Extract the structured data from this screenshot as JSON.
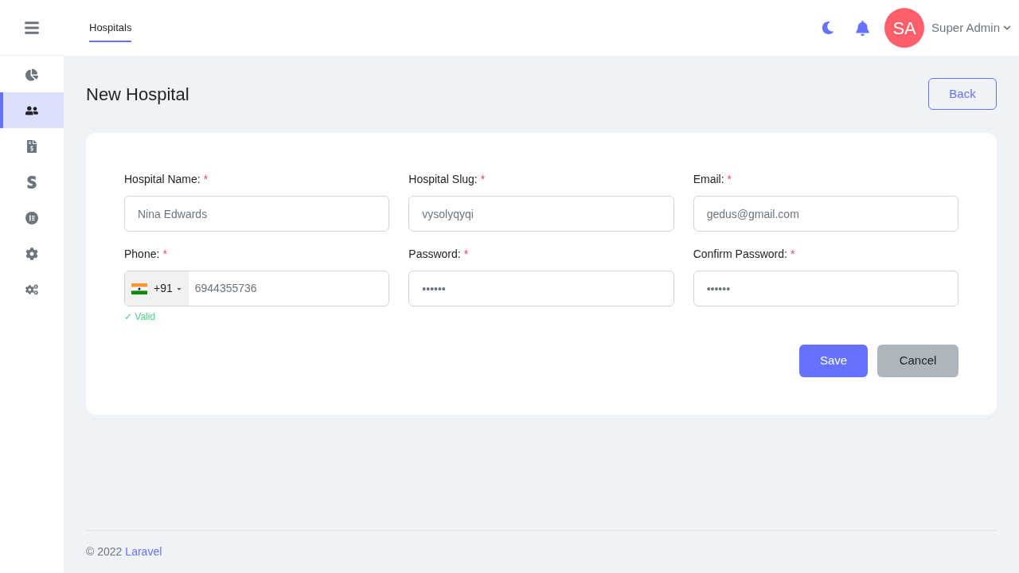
{
  "header": {
    "tabs": [
      {
        "label": "Hospitals",
        "selected": true
      }
    ],
    "avatar": "SA",
    "user": "Super Admin"
  },
  "sidebar": {
    "items": [
      {
        "kind": "chart",
        "selected": false
      },
      {
        "kind": "users",
        "selected": true
      },
      {
        "kind": "invoice",
        "selected": false
      },
      {
        "kind": "stripe",
        "selected": false
      },
      {
        "kind": "list",
        "selected": false
      },
      {
        "kind": "cog",
        "selected": false
      },
      {
        "kind": "cogs",
        "selected": false
      }
    ]
  },
  "page": {
    "title": "New Hospital",
    "back": "Back"
  },
  "form": {
    "fields": [
      {
        "kind": "text",
        "label": "Hospital Name:",
        "required": "*",
        "value": "Nina Edwards"
      },
      {
        "kind": "text",
        "label": "Hospital Slug:",
        "required": "*",
        "value": "vysolyqyqi"
      },
      {
        "kind": "text",
        "label": "Email:",
        "required": "*",
        "value": "gedus@gmail.com"
      },
      {
        "kind": "phone",
        "label": "Phone:",
        "required": "*",
        "code": "+91",
        "value": "6944355736",
        "valid": "✓ Valid"
      },
      {
        "kind": "text",
        "label": "Password:",
        "required": "*",
        "value": "••••••"
      },
      {
        "kind": "text",
        "label": "Confirm Password:",
        "required": "*",
        "value": "••••••"
      }
    ],
    "save": "Save",
    "cancel": "Cancel"
  },
  "footer": {
    "copyright": "© 2022",
    "link": "Laravel"
  }
}
